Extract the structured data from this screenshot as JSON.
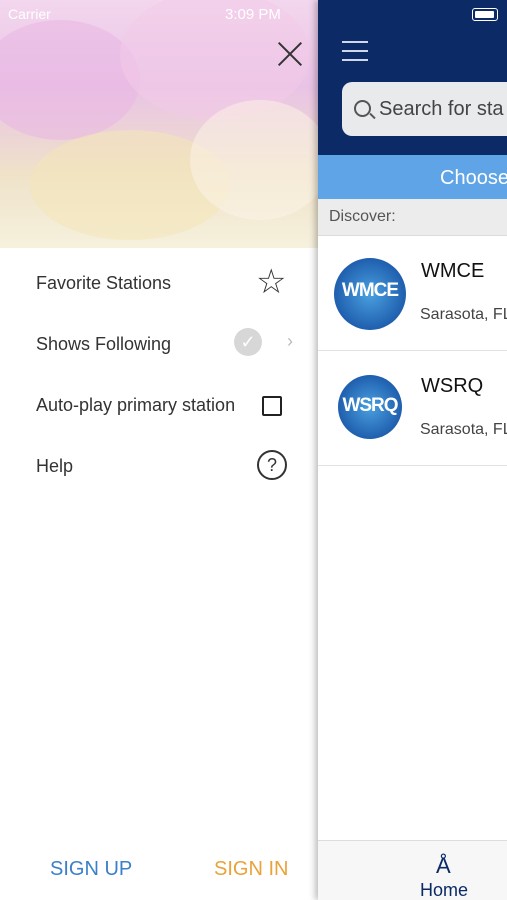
{
  "status_bar": {
    "carrier": "Carrier",
    "time": "3:09 PM"
  },
  "drawer": {
    "menu": [
      {
        "label": "Favorite Stations",
        "icon": "star-icon"
      },
      {
        "label": "Shows Following",
        "icon": "check-circle-icon"
      },
      {
        "label": "Auto-play primary station",
        "icon": "checkbox-icon",
        "checked": false
      },
      {
        "label": "Help",
        "icon": "help-icon"
      }
    ],
    "sign_up": "SIGN UP",
    "sign_in": "SIGN IN"
  },
  "main": {
    "search_placeholder": "Search for sta",
    "choose_label": "Choose",
    "discover_label": "Discover:",
    "stations": [
      {
        "name": "WMCE",
        "location": "Sarasota, FL",
        "logo": "WMCE"
      },
      {
        "name": "WSRQ",
        "location": "Sarasota, FL",
        "logo": "WSRQ"
      }
    ],
    "tab": {
      "label": "Home",
      "icon": "antenna-icon"
    }
  },
  "colors": {
    "nav": "#0b2a66",
    "choose_bar": "#5fa4e6",
    "sign_up": "#3b80c9",
    "sign_in": "#e8a33a"
  }
}
